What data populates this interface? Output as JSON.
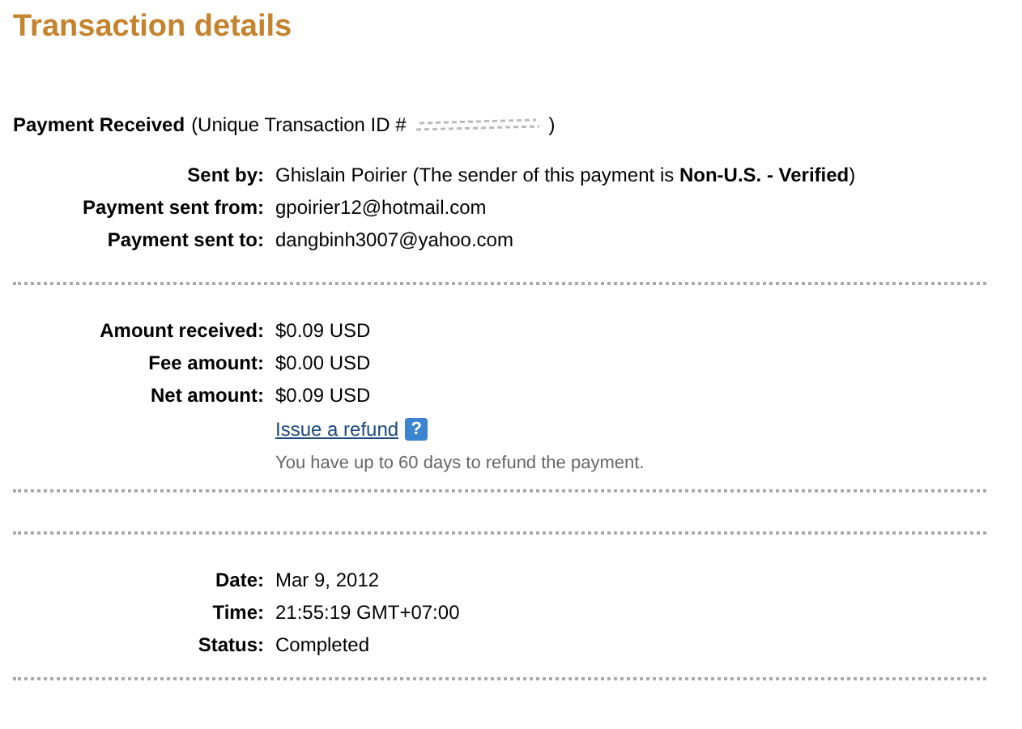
{
  "title": "Transaction details",
  "header": {
    "label": "Payment Received",
    "text": "(Unique Transaction ID #",
    "close": ")"
  },
  "sections": [
    {
      "rows": [
        {
          "label": "Sent by:",
          "value": "Ghislain Poirier (The sender of this payment is **Non-U.S. - Verified**)"
        },
        {
          "label": "Payment sent from:",
          "value": "gpoirier12@hotmail.com"
        },
        {
          "label": "Payment sent to:",
          "value": "dangbinh3007@yahoo.com"
        }
      ]
    },
    {
      "rows": [
        {
          "label": "Amount received:",
          "value": "$0.09 USD"
        },
        {
          "label": "Fee amount:",
          "value": "$0.00 USD"
        },
        {
          "label": "Net amount:",
          "value": "$0.09 USD"
        }
      ],
      "link": {
        "label": "Issue a refund",
        "help": "?"
      },
      "note": "You have up to 60 days to refund the payment."
    },
    {
      "kind": "spacer"
    },
    {
      "rows": [
        {
          "label": "Date:",
          "value": "Mar 9, 2012"
        },
        {
          "label": "Time:",
          "value": "21:55:19 GMT+07:00"
        },
        {
          "label": "Status:",
          "value": "Completed"
        }
      ]
    }
  ]
}
